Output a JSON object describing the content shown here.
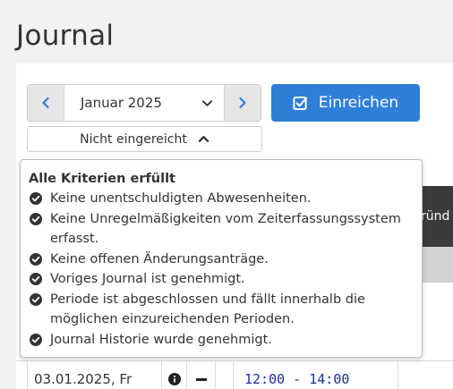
{
  "page": {
    "title": "Journal"
  },
  "toolbar": {
    "month_label": "Januar 2025",
    "submit_label": "Einreichen",
    "status_label": "Nicht eingereicht"
  },
  "popover": {
    "title": "Alle Kriterien erfüllt",
    "criteria": [
      "Keine unentschuldigten Abwesenheiten.",
      "Keine Unregelmäßigkeiten vom Zeiterfassungssystem erfasst.",
      "Keine offenen Änderungsanträge.",
      "Voriges Journal ist genehmigt.",
      "Periode ist abgeschlossen und fällt innerhalb die möglichen einzureichenden Perioden.",
      "Journal Historie wurde genehmigt."
    ]
  },
  "table": {
    "header_partial": "ründ",
    "row": {
      "date": "03.01.2025, Fr",
      "time": "12:00 - 14:00"
    }
  },
  "colors": {
    "accent": "#2f7fd8",
    "header_bg": "#3b3b3b",
    "time_text": "#1a2f9c"
  }
}
